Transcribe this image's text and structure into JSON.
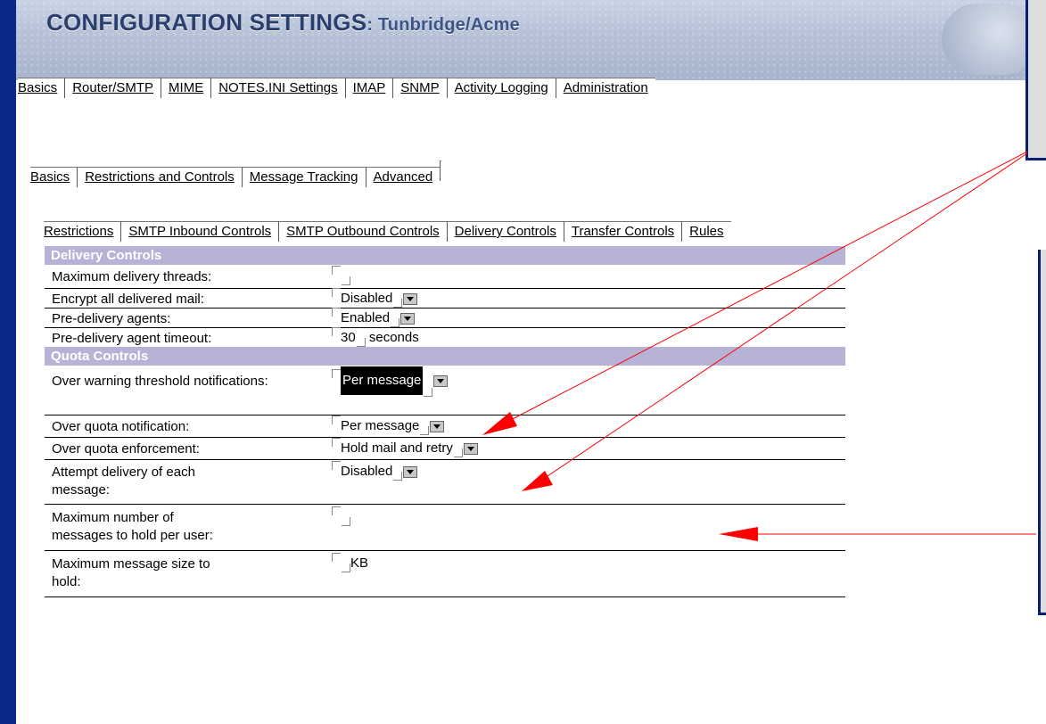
{
  "header": {
    "title": "CONFIGURATION SETTINGS",
    "subtitle": ": Tunbridge/Acme"
  },
  "tabs_l1": [
    "Basics",
    "Router/SMTP",
    "MIME",
    "NOTES.INI Settings",
    "IMAP",
    "SNMP",
    "Activity Logging",
    "Administration"
  ],
  "tabs_l2": [
    "Basics",
    "Restrictions and Controls",
    "Message Tracking",
    "Advanced"
  ],
  "tabs_l3": [
    "Restrictions",
    "SMTP Inbound Controls",
    "SMTP Outbound Controls",
    "Delivery Controls",
    "Transfer Controls",
    "Rules"
  ],
  "delivery": {
    "title": "Delivery Controls",
    "rows": [
      {
        "label": "Maximum delivery threads:",
        "value": ""
      },
      {
        "label": "Encrypt all delivered mail:",
        "value": "Disabled"
      },
      {
        "label": "Pre-delivery agents:",
        "value": "Enabled"
      },
      {
        "label": "Pre-delivery agent timeout:",
        "value": "30",
        "suffix": "seconds"
      }
    ]
  },
  "quota": {
    "title": "Quota Controls",
    "rows": [
      {
        "label": "Over warning threshold notifications:",
        "value": "Per message"
      },
      {
        "label": "Over quota notification:",
        "value": "Per message"
      },
      {
        "label": "Over quota enforcement:",
        "value": "Hold mail and retry"
      },
      {
        "label": "Attempt delivery of each message:",
        "value": "Disabled"
      },
      {
        "label": "Maximum number of messages to hold per user:",
        "value": ""
      },
      {
        "label": "Maximum message size to hold:",
        "value": "",
        "suffix": "KB"
      }
    ]
  },
  "colors": {
    "background": "#003399",
    "section_header": "#b6b3d6",
    "arrow": "#ff0000",
    "banner_title": "#2b3f6e"
  },
  "icons": [
    "dropdown-arrow-icon",
    "field-start-marker-icon",
    "field-end-marker-icon",
    "globe-logo-icon"
  ]
}
